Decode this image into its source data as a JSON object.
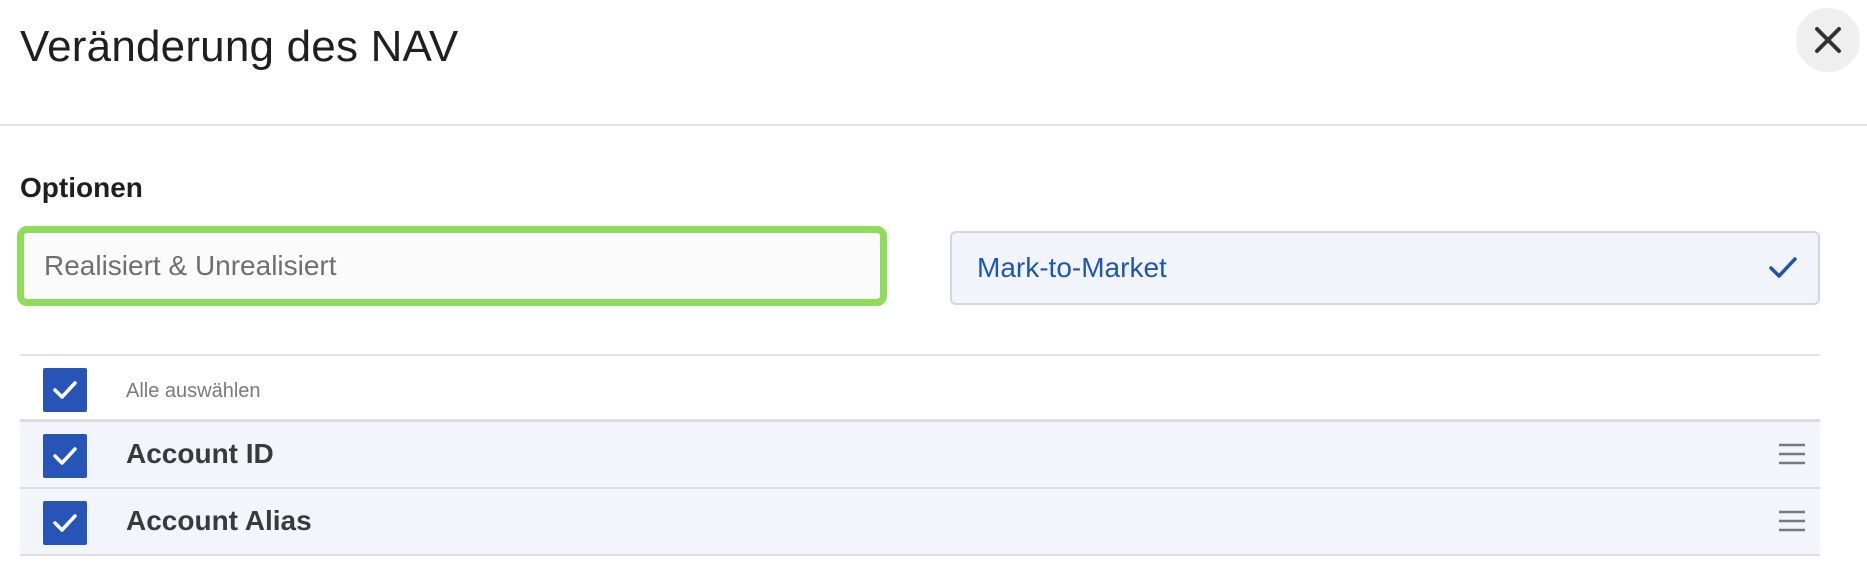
{
  "dialog": {
    "title": "Veränderung des NAV",
    "close_icon": "close-icon"
  },
  "options": {
    "label": "Optionen",
    "realized_option": "Realisiert & Unrealisiert",
    "mtm_option": "Mark-to-Market",
    "mtm_selected_icon": "checkmark-icon"
  },
  "columns": {
    "select_all_label": "Alle auswählen",
    "items": [
      {
        "label": "Account ID",
        "checked": true
      },
      {
        "label": "Account Alias",
        "checked": true
      }
    ]
  },
  "colors": {
    "accent": "#2654b7",
    "highlight_border": "#8fdc5c",
    "link_text": "#1f56b4"
  }
}
